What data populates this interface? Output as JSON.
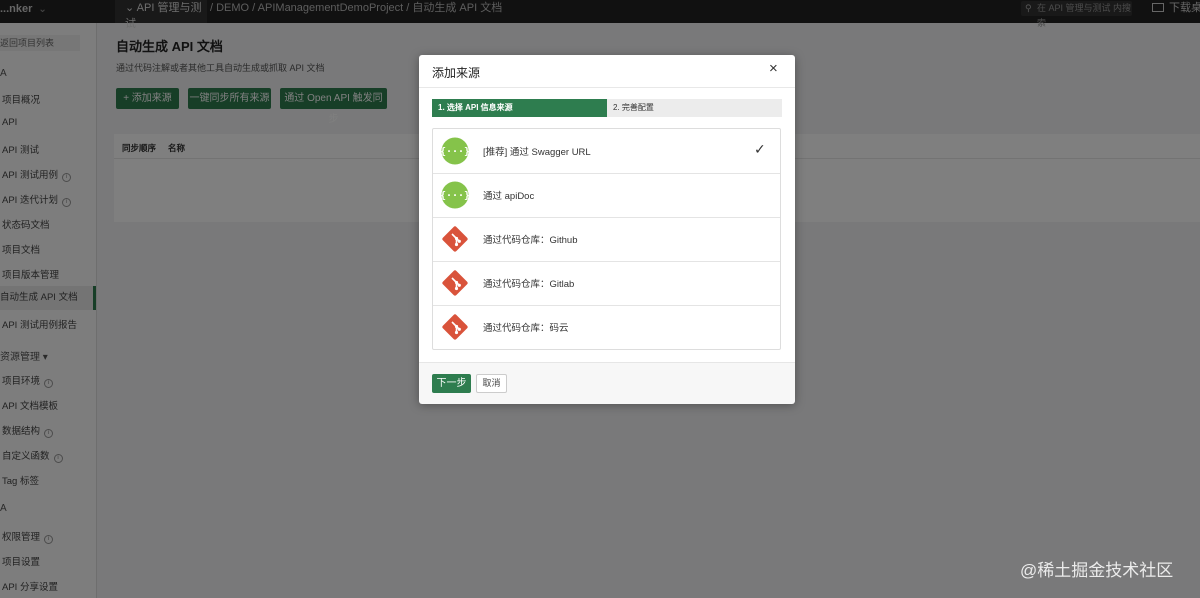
{
  "topbar": {
    "brand": "...nker",
    "module": "API 管理与测试",
    "breadcrumb": "/ DEMO / APIManagementDemoProject / 自动生成 API 文档",
    "search_placeholder": "在 API 管理与测试 内搜索",
    "download": "下载桌面"
  },
  "sidebar": {
    "back": "返回项目列表",
    "group1": "A",
    "items1": [
      "项目概况",
      "API",
      "API 测试",
      "API 测试用例",
      "API 迭代计划",
      "状态码文档",
      "项目文档",
      "项目版本管理",
      "自动生成 API 文档",
      "API 测试用例报告"
    ],
    "group2": "资源管理 ▾",
    "items2": [
      "项目环境",
      "API 文档模板",
      "数据结构",
      "自定义函数",
      "Tag 标签"
    ],
    "group3": "A",
    "items3": [
      "权限管理",
      "项目设置",
      "API 分享设置"
    ]
  },
  "main": {
    "title": "自动生成 API 文档",
    "desc": "通过代码注解或者其他工具自动生成或抓取 API 文档",
    "btn_add": "+ 添加来源",
    "btn_sync_all": "一键同步所有来源",
    "btn_openapi": "通过 Open API 触发同步",
    "col_order": "同步顺序",
    "col_name": "名称"
  },
  "modal": {
    "title": "添加来源",
    "close": "×",
    "step1": "1. 选择 API 信息来源",
    "step2": "2. 完善配置",
    "options": [
      {
        "label": "[推荐] 通过 Swagger URL",
        "icon": "swagger-icon",
        "selected": true
      },
      {
        "label": "通过 apiDoc",
        "icon": "swagger-icon",
        "selected": false
      },
      {
        "label": "通过代码仓库：Github",
        "icon": "git-icon",
        "selected": false
      },
      {
        "label": "通过代码仓库：Gitlab",
        "icon": "git-icon",
        "selected": false
      },
      {
        "label": "通过代码仓库：码云",
        "icon": "git-icon",
        "selected": false
      }
    ],
    "check": "✓",
    "next": "下一步",
    "cancel": "取消"
  },
  "colors": {
    "accent": "#2e7d4f",
    "swagger": "#85c34a",
    "git": "#d9533b"
  },
  "watermark": "@稀土掘金技术社区"
}
